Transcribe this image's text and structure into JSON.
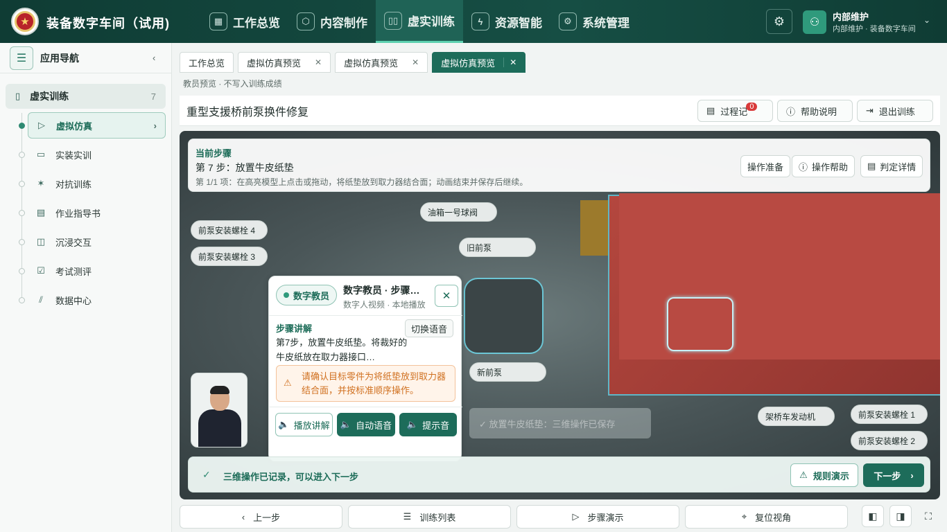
{
  "app": {
    "title": "装备数字车间（试用)",
    "logo_glyph": "★"
  },
  "nav": [
    {
      "label": "工作总览",
      "icon": "grid-icon",
      "glyph": "▦"
    },
    {
      "label": "内容制作",
      "icon": "cube-icon",
      "glyph": "⬡"
    },
    {
      "label": "虚实训练",
      "icon": "book-icon",
      "glyph": "▯▯"
    },
    {
      "label": "资源智能",
      "icon": "plug-icon",
      "glyph": "ϟ"
    },
    {
      "label": "系统管理",
      "icon": "gear-icon",
      "glyph": "⚙"
    }
  ],
  "user": {
    "name": "内部维护",
    "org": "内部维护 · 装备数字车间"
  },
  "sidebar": {
    "title": "应用导航",
    "group": {
      "label": "虚实训练",
      "count": "7"
    },
    "items": [
      {
        "label": "虚拟仿真",
        "icon": "play-circle-icon",
        "glyph": "▷"
      },
      {
        "label": "实装实训",
        "icon": "monitor-icon",
        "glyph": "▭"
      },
      {
        "label": "对抗训练",
        "icon": "fight-icon",
        "glyph": "✶"
      },
      {
        "label": "作业指导书",
        "icon": "document-icon",
        "glyph": "▤"
      },
      {
        "label": "沉浸交互",
        "icon": "vr-icon",
        "glyph": "◫"
      },
      {
        "label": "考试测评",
        "icon": "exam-icon",
        "glyph": "☑"
      },
      {
        "label": "数据中心",
        "icon": "chart-icon",
        "glyph": "⫽"
      }
    ]
  },
  "tabs": [
    {
      "label": "工作总览"
    },
    {
      "label": "虚拟仿真预览"
    },
    {
      "label": "虚拟仿真预览"
    },
    {
      "label": "虚拟仿真预览"
    }
  ],
  "note": "教员预览 · 不写入训练成绩",
  "page": {
    "title": "重型支援桥前泵换件修复",
    "record_label": "过程记",
    "record_badge": "0",
    "help_label": "帮助说明",
    "exit_label": "退出训练"
  },
  "step": {
    "header": "当前步骤",
    "title": "第 7 步：放置牛皮纸垫",
    "desc": "第 1/1 项：在高亮模型上点击或拖动，将纸垫放到取力器结合面；动画结束并保存后继续。",
    "prep_label": "操作准备",
    "help_label": "操作帮助",
    "judge_label": "判定详情"
  },
  "scene_labels": [
    "前泵安装螺栓 4",
    "前泵安装螺栓 3",
    "油箱一号球阀",
    "旧前泵",
    "新前泵",
    "架桥车发动机",
    "前泵安装螺栓 1",
    "前泵安装螺栓 2"
  ],
  "ghost_text": "✓   放置牛皮纸垫：三维操作已保存",
  "teacher": {
    "pill": "数字教员",
    "title": "数字教员 · 步骤讲解",
    "subtitle": "数字人视频 · 本地播放",
    "section": "步骤讲解",
    "switch_label": "切换语音",
    "body": "第7步，放置牛皮纸垫。将裁好的牛皮纸放在取力器接口…",
    "warning": "请确认目标零件为将纸垫放到取力器结合面，并按标准顺序操作。",
    "play_label": "播放讲解",
    "auto_label": "自动语音",
    "tone_label": "提示音"
  },
  "status": {
    "message": "三维操作已记录，可以进入下一步",
    "rule_label": "规则演示",
    "next_label": "下一步"
  },
  "footer": {
    "prev_label": "上一步",
    "list_label": "训练列表",
    "demo_label": "步骤演示",
    "reset_label": "复位视角"
  }
}
